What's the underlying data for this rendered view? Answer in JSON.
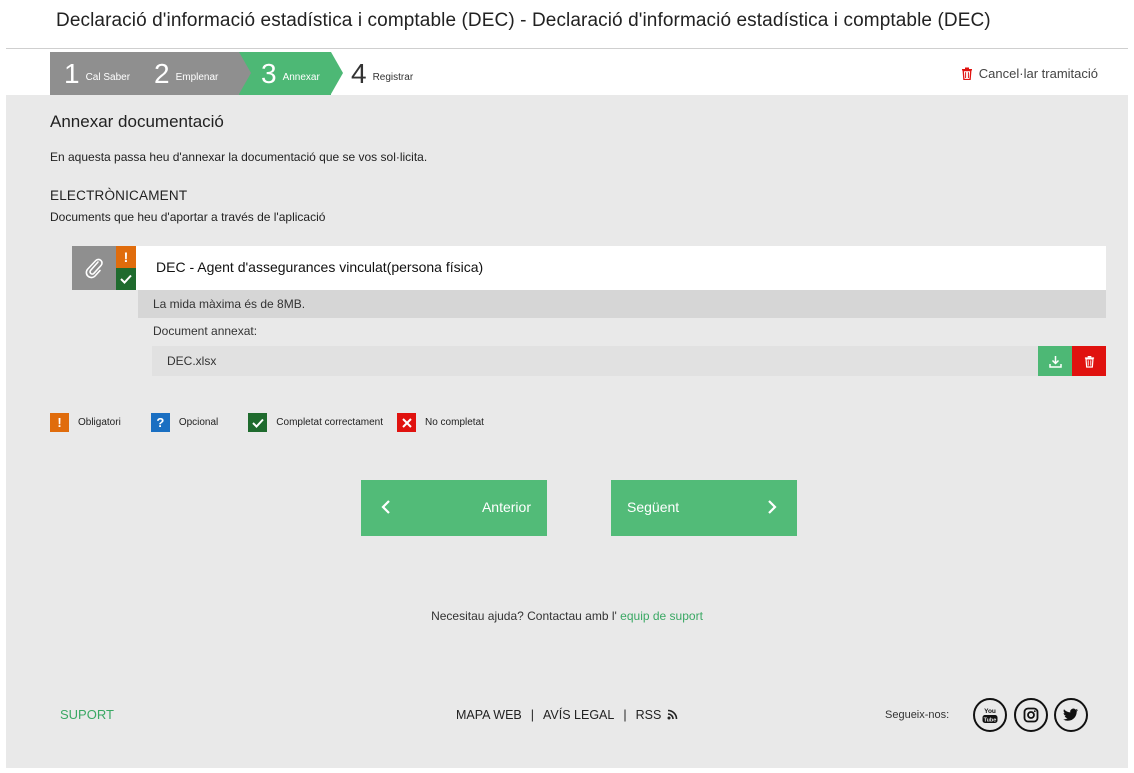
{
  "page_title": "Declaració d'informació estadística i comptable (DEC) - Declaració d'informació estadística i comptable (DEC)",
  "steps": [
    {
      "num": "1",
      "label": "Cal Saber"
    },
    {
      "num": "2",
      "label": "Emplenar"
    },
    {
      "num": "3",
      "label": "Annexar"
    },
    {
      "num": "4",
      "label": "Registrar"
    }
  ],
  "cancel_label": "Cancel·lar tramitació",
  "main": {
    "heading": "Annexar documentació",
    "intro": "En aquesta passa heu d'annexar la documentació que se vos sol·licita.",
    "electronic_heading": "ELECTRÒNICAMENT",
    "electronic_sub": "Documents que heu d'aportar a través de l'aplicació",
    "document": {
      "required_mark": "!",
      "title": "DEC - Agent d'assegurances vinculat(persona física)",
      "max_size": "La mida màxima és de 8MB.",
      "annexed_label": "Document annexat:",
      "file_name": "DEC.xlsx"
    }
  },
  "legend": {
    "required_mark": "!",
    "required": "Obligatori",
    "optional_mark": "?",
    "optional": "Opcional",
    "completed": "Completat correctament",
    "not_completed": "No completat"
  },
  "nav": {
    "prev": "Anterior",
    "next": "Següent"
  },
  "help": {
    "text": "Necesitau ajuda? Contactau amb l'",
    "link": "equip de suport"
  },
  "footer": {
    "suport": "SUPORT",
    "links": [
      "MAPA WEB",
      "AVÍS LEGAL",
      "RSS"
    ],
    "separator": "|",
    "follow": "Segueix-nos:",
    "social_icons": [
      "youtube-icon",
      "instagram-icon",
      "twitter-icon"
    ]
  },
  "colors": {
    "green": "#4db875",
    "gray": "#8f8f8f",
    "orange": "#e06c0c",
    "dark_green": "#1f6b2e",
    "blue": "#1a6fc2",
    "red": "#e0120f"
  }
}
